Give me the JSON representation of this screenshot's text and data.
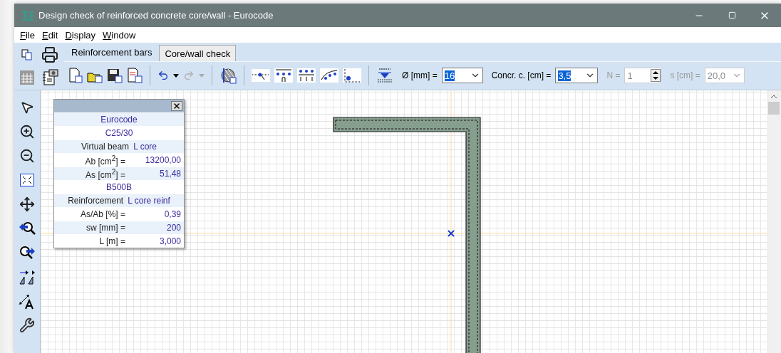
{
  "window": {
    "title": "Design check of reinforced concrete core/wall - Eurocode"
  },
  "menu": [
    "File",
    "Edit",
    "Display",
    "Window"
  ],
  "tabs": [
    {
      "label": "Reinforcement bars",
      "selected": true
    },
    {
      "label": "Core/wall check",
      "selected": false
    }
  ],
  "fields": [
    {
      "kind": "combo",
      "label": "Ø [mm] =",
      "value": "16",
      "disabled": false,
      "highlighted": true
    },
    {
      "kind": "combo",
      "label": "Concr. c. [cm] =",
      "value": "3,5",
      "disabled": false,
      "highlighted": true
    },
    {
      "kind": "spin",
      "label": "N =",
      "value": "1",
      "disabled": true,
      "highlighted": false
    },
    {
      "kind": "combo",
      "label": "s [cm] =",
      "value": "20,0",
      "disabled": true,
      "highlighted": false
    }
  ],
  "info_panel": {
    "rows": [
      {
        "kind": "title",
        "label": "Eurocode"
      },
      {
        "kind": "title",
        "label": "C25/30"
      },
      {
        "kind": "section",
        "label": "Virtual beam",
        "value": "L core"
      },
      {
        "kind": "pair",
        "label": "Ab [cm$^{2}$] =",
        "value": "13200,00"
      },
      {
        "kind": "pair",
        "label": "As [cm$^{2}$] =",
        "value": "51,48"
      },
      {
        "kind": "title",
        "label": "B500B"
      },
      {
        "kind": "section",
        "label": "Reinforcement",
        "value": "L core reinf"
      },
      {
        "kind": "pair",
        "label": "As/Ab [%] =",
        "value": "0,39"
      },
      {
        "kind": "pair",
        "label": "sw [mm] =",
        "value": "200"
      },
      {
        "kind": "pair",
        "label": "L [m] =",
        "value": "3,000"
      }
    ]
  }
}
